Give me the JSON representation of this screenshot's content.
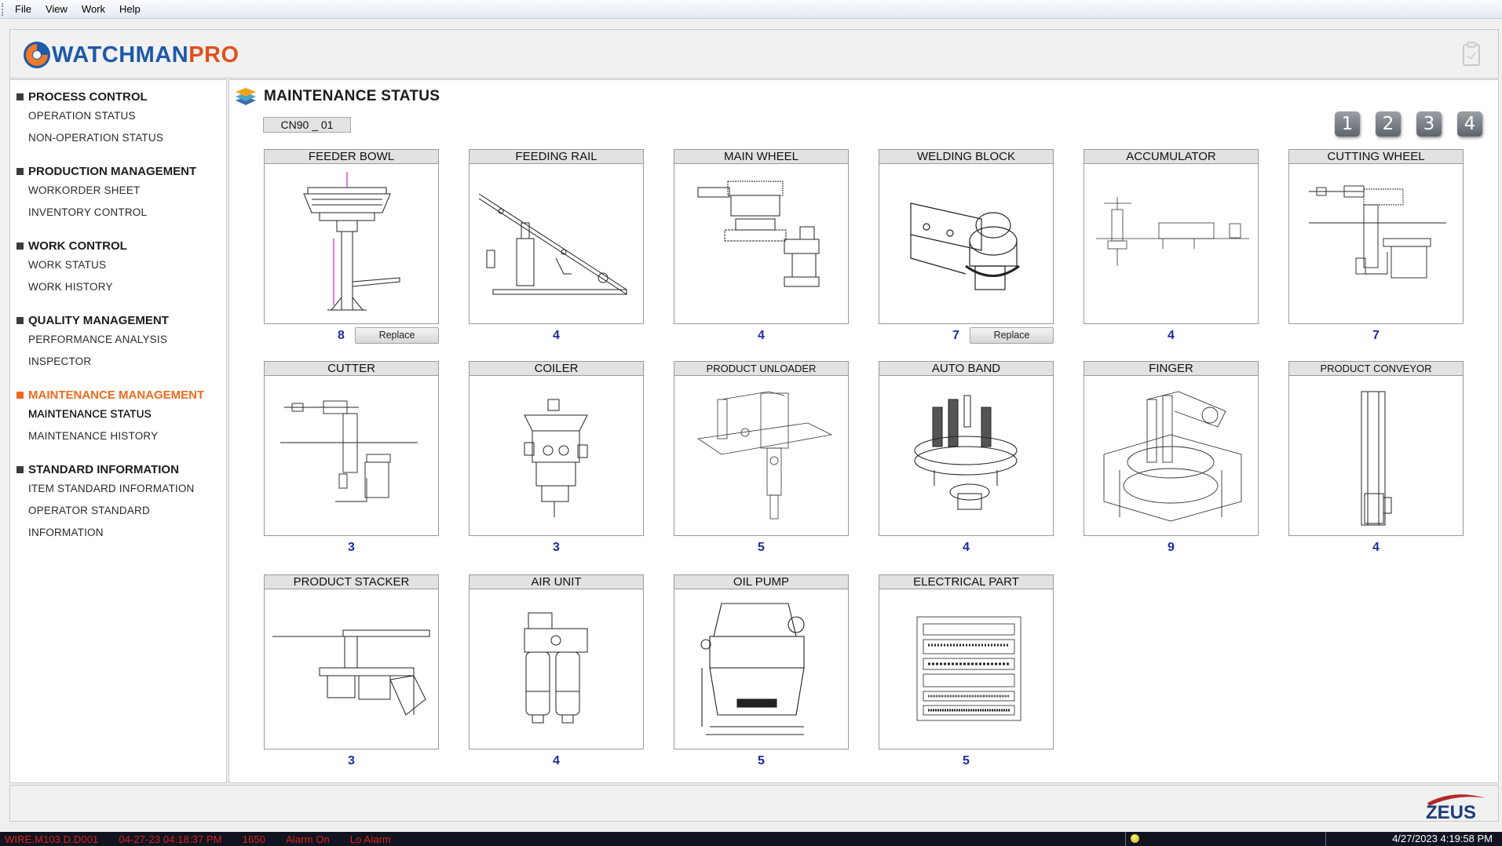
{
  "menubar": {
    "items": [
      "File",
      "View",
      "Work",
      "Help"
    ]
  },
  "header": {
    "logo_part1": "WATCHMAN",
    "logo_part2": "PRO",
    "clipboard_icon": "clipboard-icon"
  },
  "sidebar": {
    "groups": [
      {
        "title": "PROCESS CONTROL",
        "items": [
          "OPERATION STATUS",
          "NON-OPERATION STATUS"
        ]
      },
      {
        "title": "PRODUCTION MANAGEMENT",
        "items": [
          "WORKORDER SHEET",
          "INVENTORY CONTROL"
        ]
      },
      {
        "title": "WORK CONTROL",
        "items": [
          "WORK STATUS",
          "WORK HISTORY"
        ]
      },
      {
        "title": "QUALITY MANAGEMENT",
        "items": [
          "PERFORMANCE ANALYSIS",
          "INSPECTOR"
        ]
      },
      {
        "title": "MAINTENANCE MANAGEMENT",
        "items": [
          "MAINTENANCE STATUS",
          "MAINTENANCE HISTORY"
        ]
      },
      {
        "title": "STANDARD INFORMATION",
        "items": [
          "ITEM STANDARD INFORMATION",
          "OPERATOR STANDARD INFORMATION"
        ]
      }
    ],
    "active_group": "MAINTENANCE MANAGEMENT",
    "active_item": "MAINTENANCE STATUS",
    "accent_color": "#ef6a1c"
  },
  "main": {
    "title": "MAINTENANCE STATUS",
    "machine": "CN90 _ 01",
    "pages": [
      "1",
      "2",
      "3",
      "4"
    ],
    "replace_label": "Replace",
    "count_color": "#1b2c9e",
    "parts": [
      {
        "name": "FEEDER BOWL",
        "count": "8",
        "replace": true
      },
      {
        "name": "FEEDING RAIL",
        "count": "4",
        "replace": false
      },
      {
        "name": "MAIN WHEEL",
        "count": "4",
        "replace": false
      },
      {
        "name": "WELDING BLOCK",
        "count": "7",
        "replace": true
      },
      {
        "name": "ACCUMULATOR",
        "count": "4",
        "replace": false
      },
      {
        "name": "CUTTING WHEEL",
        "count": "7",
        "replace": false
      },
      {
        "name": "CUTTER",
        "count": "3",
        "replace": false
      },
      {
        "name": "COILER",
        "count": "3",
        "replace": false
      },
      {
        "name": "PRODUCT UNLOADER",
        "count": "5",
        "replace": false
      },
      {
        "name": "AUTO BAND",
        "count": "4",
        "replace": false
      },
      {
        "name": "FINGER",
        "count": "9",
        "replace": false
      },
      {
        "name": "PRODUCT CONVEYOR",
        "count": "4",
        "replace": false
      },
      {
        "name": "PRODUCT STACKER",
        "count": "3",
        "replace": false
      },
      {
        "name": "AIR UNIT",
        "count": "4",
        "replace": false
      },
      {
        "name": "OIL PUMP",
        "count": "5",
        "replace": false
      },
      {
        "name": "ELECTRICAL PART",
        "count": "5",
        "replace": false
      }
    ]
  },
  "footer": {
    "brand": "ZEUS"
  },
  "statusbar": {
    "device": "WIRE.M103.D.D001",
    "alarm_time": "04-27-23 04:18:37 PM",
    "code": "1650",
    "alarm_state": "Alarm On",
    "alarm_level": "Lo Alarm",
    "clock": "4/27/2023 4:19:58 PM"
  }
}
